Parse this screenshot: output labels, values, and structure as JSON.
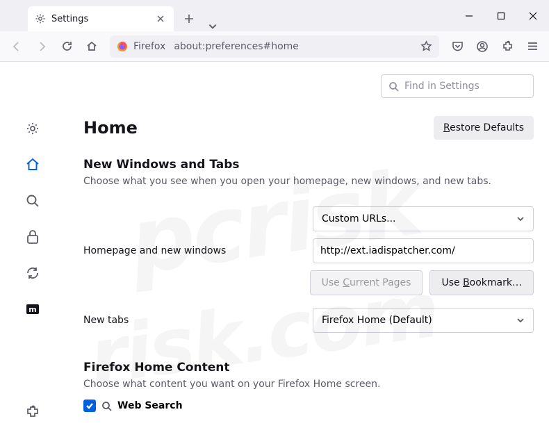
{
  "tab": {
    "title": "Settings"
  },
  "urlbar": {
    "identity": "Firefox",
    "url": "about:preferences#home"
  },
  "search": {
    "placeholder": "Find in Settings"
  },
  "page": {
    "title": "Home",
    "restore_label": "Restore Defaults",
    "restore_accesskey": "R"
  },
  "section1": {
    "heading": "New Windows and Tabs",
    "desc": "Choose what you see when you open your homepage, new windows, and new tabs.",
    "homepage_label": "Homepage and new windows",
    "custom_urls": "Custom URLs...",
    "homepage_value": "http://ext.iadispatcher.com/",
    "use_current": "Use Current Pages",
    "use_bookmark": "Use Bookmark…",
    "newtabs_label": "New tabs",
    "newtabs_value": "Firefox Home (Default)"
  },
  "section2": {
    "heading": "Firefox Home Content",
    "desc": "Choose what content you want on your Firefox Home screen.",
    "websearch": "Web Search"
  }
}
